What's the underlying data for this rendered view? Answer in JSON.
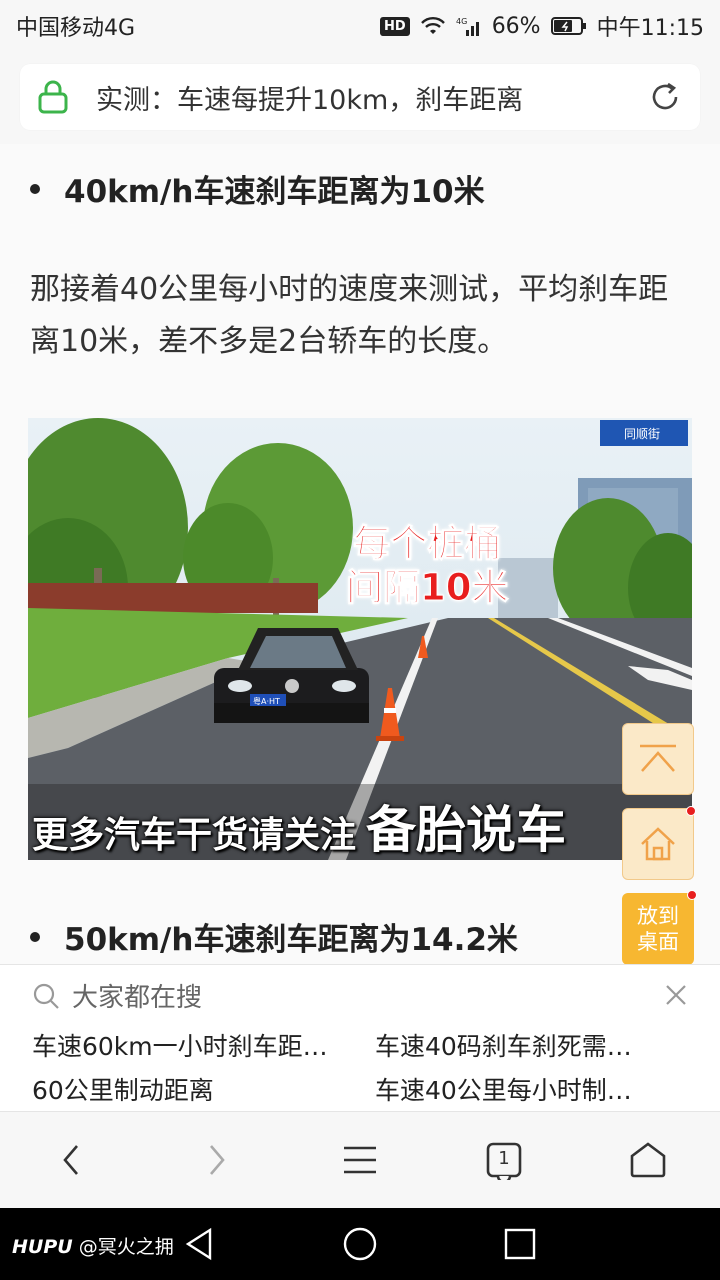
{
  "status_bar": {
    "carrier": "中国移动4G",
    "hd": "HD",
    "network": "4G",
    "battery": "66%",
    "time": "中午11:15"
  },
  "address_bar": {
    "title": "实测：车速每提升10km，刹车距离"
  },
  "article": {
    "heading_40": "40km/h车速刹车距离为10米",
    "paragraph_40": "那接着40公里每小时的速度来测试，平均刹车距离10米，差不多是2台轿车的长度。",
    "photo": {
      "overlay_line1": "每个桩桶",
      "overlay_line2": "间隔10米",
      "caption_a": "更多汽车干货请关注",
      "caption_b": "备胎说车",
      "plate": "粤A·HT",
      "sign_text": "同顺街"
    },
    "heading_50": "50km/h车速刹车距离为14.2米"
  },
  "floating": {
    "desktop_line1": "放到",
    "desktop_line2": "桌面"
  },
  "suggest": {
    "header": "大家都在搜",
    "items": [
      "车速60km一小时刹车距…",
      "车速40码刹车刹死需…",
      "60公里制动距离",
      "车速40公里每小时制…"
    ]
  },
  "toolbar": {
    "tab_count": "1"
  },
  "watermark": {
    "brand": "HUPU",
    "user": "@冥火之拥"
  },
  "colors": {
    "accent_green": "#3cb44b",
    "overlay_red": "#e81e1e",
    "desktop_orange": "#f7b731"
  }
}
